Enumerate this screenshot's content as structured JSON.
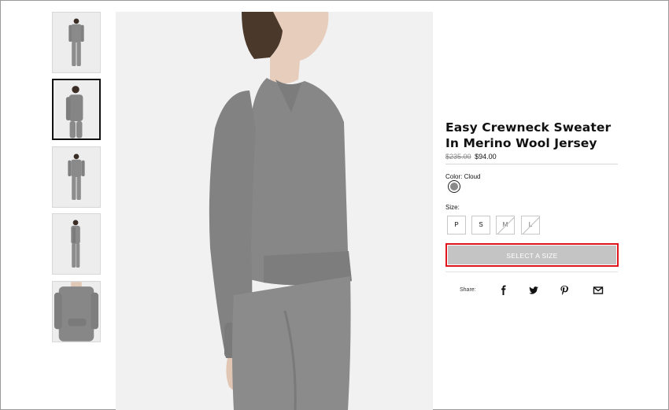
{
  "product": {
    "title_line1": "Easy Crewneck Sweater",
    "title_line2": "In Merino Wool Jersey",
    "price_original": "$235.00",
    "price_sale": "$94.00",
    "color_label": "Color: Cloud",
    "color_swatch_hex": "#8a8a8a",
    "size_label": "Size:",
    "sizes": [
      {
        "label": "P",
        "available": true
      },
      {
        "label": "S",
        "available": true
      },
      {
        "label": "M",
        "available": false
      },
      {
        "label": "L",
        "available": false
      }
    ],
    "cta_label": "SELECT A SIZE"
  },
  "share": {
    "label": "Share:",
    "icons": [
      "facebook-icon",
      "twitter-icon",
      "pinterest-icon",
      "email-icon"
    ]
  },
  "gallery": {
    "thumbnails": [
      "full-body-front-view",
      "upper-body-side-view",
      "full-body-front-view-2",
      "full-body-side-view",
      "closeup-detail-view"
    ],
    "active_index": 1
  },
  "colors": {
    "sweater_gray": "#858585",
    "cta_disabled": "#c4c4c4",
    "cta_highlight": "#e0141d"
  }
}
